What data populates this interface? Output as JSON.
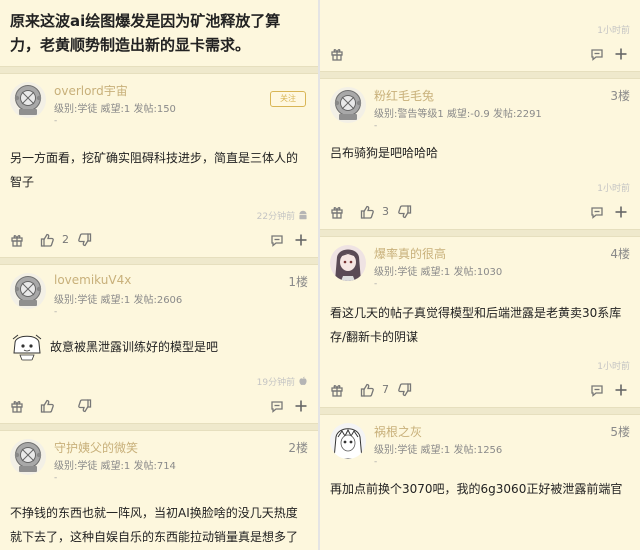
{
  "left": {
    "title": "原来这波ai绘图爆发是因为矿池释放了算力，老黄顺势制造出新的显卡需求。",
    "op": {
      "username": "overlord宇宙",
      "meta": "级别:学徒 威望:1 发帖:150",
      "dot": "-",
      "follow_label": "关注",
      "content": "另一方面看，挖矿确实阻碍科技进步，简直是三体人的智子",
      "time": "22分钟前",
      "like_count": "2"
    },
    "reply1": {
      "username": "lovemikuV4x",
      "floor": "1楼",
      "meta": "级别:学徒 威望:1 发帖:2606",
      "dot": "-",
      "content": "故意被黑泄露训练好的模型是吧",
      "time": "19分钟前"
    },
    "reply2": {
      "username": "守护姨父的微笑",
      "floor": "2楼",
      "meta": "级别:学徒 威望:1 发帖:714",
      "dot": "-",
      "content": "不挣钱的东西也就一阵风，当初AI换脸啥的没几天热度就下去了，这种自娱自乐的东西能拉动销量真是想多了"
    }
  },
  "right": {
    "top": {
      "time": "1小时前"
    },
    "reply3": {
      "username": "粉红毛毛兔",
      "floor": "3楼",
      "meta": "级别:警告等级1 威望:-0.9 发帖:2291",
      "dot": "-",
      "content": "吕布骑狗是吧哈哈哈",
      "time": "1小时前",
      "like_count": "3"
    },
    "reply4": {
      "username": "爆率真的很高",
      "floor": "4楼",
      "meta": "级别:学徒 威望:1 发帖:1030",
      "dot": "-",
      "content": "看这几天的帖子真觉得模型和后端泄露是老黄卖30系库存/翻新卡的阴谋",
      "time": "1小时前",
      "like_count": "7"
    },
    "reply5": {
      "username": "祸根之灰",
      "floor": "5楼",
      "meta": "级别:学徒 威望:1 发帖:1256",
      "dot": "-",
      "content": "再加点前换个3070吧，我的6g3060正好被泄露前端官"
    }
  },
  "colors": {
    "page_bg": "#fdf7dd",
    "username": "#c8b07a",
    "follow": "#d9b656"
  }
}
